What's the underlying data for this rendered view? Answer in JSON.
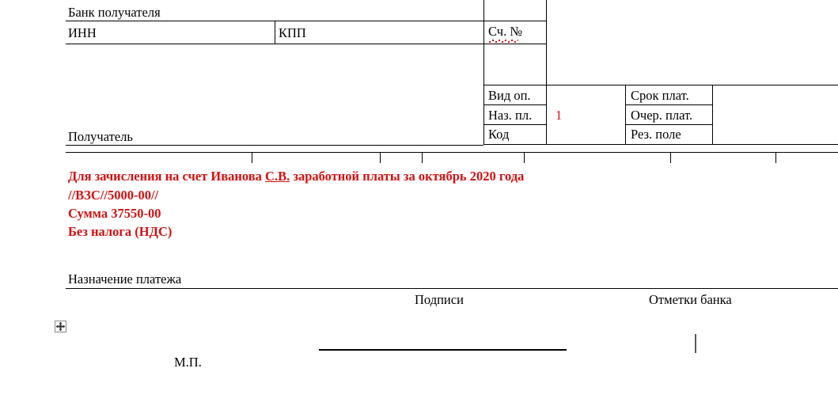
{
  "document": {
    "title": "Платежное поручение — нижняя часть бланка",
    "language": "ru",
    "accent_red": "#d41111",
    "line_color": "#000000"
  },
  "fields": {
    "bank_recipient_label": "Банк получателя",
    "inn_label": "ИНН",
    "kpp_label": "КПП",
    "account_label": "Сч. №",
    "recipient_label": "Получатель",
    "vid_op_label": "Вид оп.",
    "naz_pl_label": "Наз. пл.",
    "kod_label": "Код",
    "srok_plat_label": "Срок плат.",
    "ocher_plat_label": "Очер. плат.",
    "rez_pole_label": "Рез. поле",
    "purpose_label": "Назначение платежа",
    "signatures_label": "Подписи",
    "bank_marks_label": "Отметки банка",
    "stamp_label": "М.П."
  },
  "values": {
    "vid_op_value": "",
    "naz_pl_value": "1",
    "kod_value": "",
    "srok_plat_value": "",
    "ocher_plat_value": "",
    "rez_pole_value": "",
    "inn_value": "",
    "kpp_value": "",
    "account_value": "",
    "bank_recipient_value": "",
    "recipient_value": ""
  },
  "purpose_text": {
    "line1_part1": "Для зачисления на счет Иванова ",
    "line1_initials": "С.В.",
    "line1_part2": " заработной платы за октябрь 2020 года",
    "line2": "//ВЗС//5000-00//",
    "line3": "Сумма 37550-00",
    "line4": "Без налога (НДС)"
  },
  "icons": {
    "move_handle": "move-handle-icon",
    "text_caret": "text-caret"
  }
}
